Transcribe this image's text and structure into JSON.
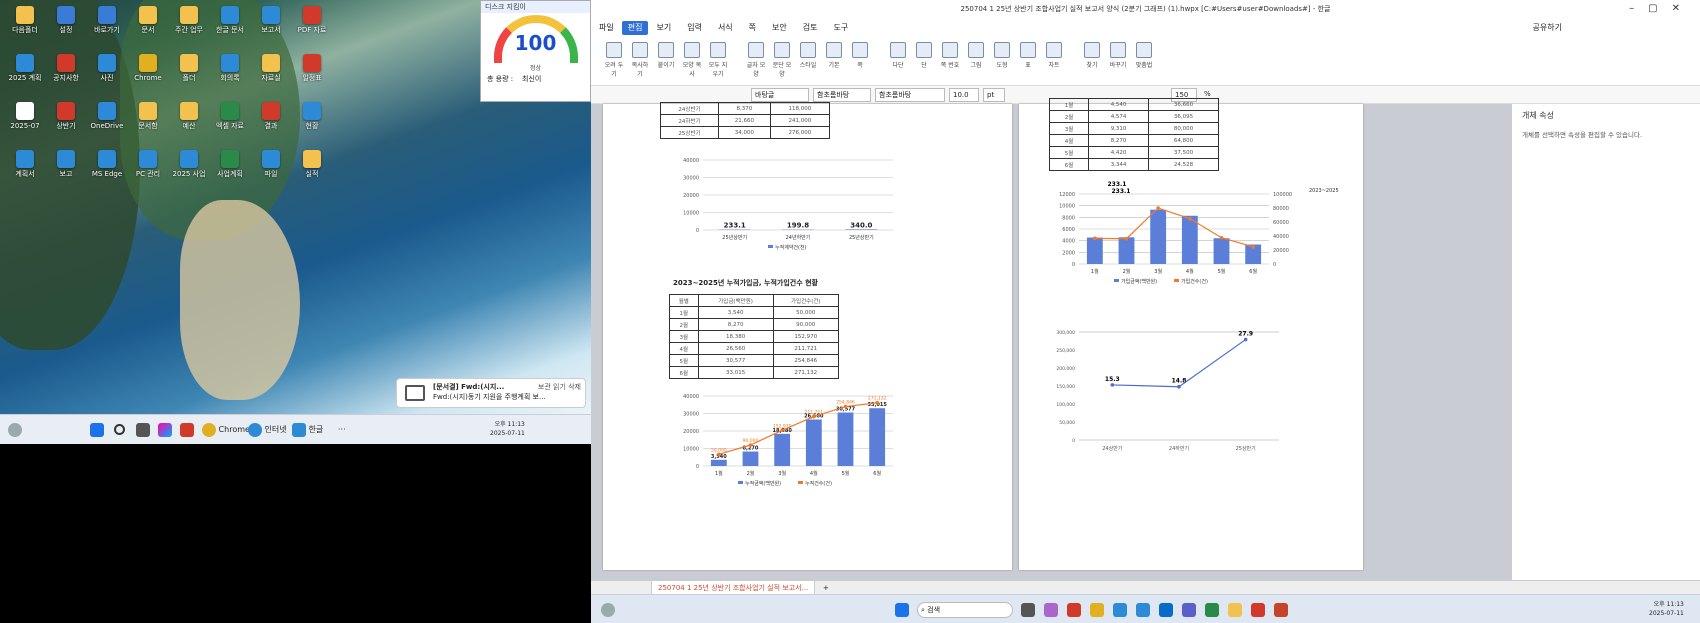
{
  "gauge": {
    "title": "디스크 지킴이",
    "value": "100",
    "sub": "정상",
    "label": "총 용량 :",
    "status": "최신이"
  },
  "notify": {
    "title": "[문서결] Fwd:(시지...",
    "body": "Fwd:(시지)동기 지원을 주행계획 보...",
    "actions": "보관  읽기  삭제"
  },
  "left_taskbar": {
    "search": "",
    "chrome": "Chrome",
    "edge": "인터넷",
    "hwp": "한글",
    "time": "오후 11:13",
    "date": "2025-07-11"
  },
  "desktop_icons": [
    {
      "label": "다음폴더",
      "color": "#f2c14e"
    },
    {
      "label": "설정",
      "color": "#3a7bd5"
    },
    {
      "label": "바로가기",
      "color": "#3a7bd5"
    },
    {
      "label": "문서",
      "color": "#f2c14e"
    },
    {
      "label": "주간 업무",
      "color": "#f2c14e"
    },
    {
      "label": "한글 문서",
      "color": "#2d8ad6"
    },
    {
      "label": "보고서",
      "color": "#2d8ad6"
    },
    {
      "label": "PDF 자료",
      "color": "#d13a2a"
    },
    {
      "label": "2025 계획",
      "color": "#2d8ad6"
    },
    {
      "label": "공지사항",
      "color": "#d13a2a"
    },
    {
      "label": "사진",
      "color": "#2d8ad6"
    },
    {
      "label": "Chrome",
      "color": "#e0b020"
    },
    {
      "label": "폴더",
      "color": "#f2c14e"
    },
    {
      "label": "회의록",
      "color": "#2d8ad6"
    },
    {
      "label": "자료실",
      "color": "#f2c14e"
    },
    {
      "label": "일정표",
      "color": "#d13a2a"
    },
    {
      "label": "2025-07",
      "color": "#fff"
    },
    {
      "label": "상반기",
      "color": "#d13a2a"
    },
    {
      "label": "OneDrive",
      "color": "#2d8ad6"
    },
    {
      "label": "문서함",
      "color": "#f2c14e"
    },
    {
      "label": "예산",
      "color": "#f2c14e"
    },
    {
      "label": "엑셀 자료",
      "color": "#2a8a4a"
    },
    {
      "label": "결과",
      "color": "#d13a2a"
    },
    {
      "label": "현황",
      "color": "#2d8ad6"
    },
    {
      "label": "계획서",
      "color": "#2d8ad6"
    },
    {
      "label": "보고",
      "color": "#2d8ad6"
    },
    {
      "label": "MS Edge",
      "color": "#2d8ad6"
    },
    {
      "label": "PC 관리",
      "color": "#2d8ad6"
    },
    {
      "label": "2025 사업",
      "color": "#2d8ad6"
    },
    {
      "label": "사업계획",
      "color": "#2a8a4a"
    },
    {
      "label": "파일",
      "color": "#2d8ad6"
    },
    {
      "label": "실적",
      "color": "#f2c14e"
    }
  ],
  "window": {
    "title": "250704 1 25년 상반기 조합사업기 실적 보고서 양식 (2분기 그래프) (1).hwpx [C:#Users#user#Downloads#]  - 한글",
    "share": "공유하기"
  },
  "menu": [
    "파일",
    "편집",
    "보기",
    "입력",
    "서식",
    "쪽",
    "보안",
    "검토",
    "도구"
  ],
  "ribbon": [
    "오려 두기",
    "복사하기",
    "붙이기",
    "모양 복사",
    "모두 지우기",
    "글자 모양",
    "문단 모양",
    "스타일",
    "기본",
    "쪽",
    "다단",
    "단",
    "쪽 번호",
    "그림",
    "도형",
    "표",
    "차트",
    "찾기",
    "바꾸기",
    "맞춤법"
  ],
  "format": {
    "style": "바탕글",
    "font": "함초롬바탕",
    "size": "10.0",
    "unit": "pt",
    "zoom": "150",
    "pct": "%"
  },
  "page1": {
    "table1_rows": [
      [
        "24상반기",
        "8,370",
        "118,000"
      ],
      [
        "24하반기",
        "21,660",
        "241,000"
      ],
      [
        "25상반기",
        "34,000",
        "276,000"
      ]
    ],
    "chart1": {
      "type": "bar",
      "categories": [
        "25년상반기",
        "24년하반기",
        "25년상반기"
      ],
      "values": [
        233.1,
        199.8,
        340.0
      ],
      "labels": [
        "233.1",
        "199.8",
        "340.0"
      ],
      "ylim": [
        0,
        40000
      ],
      "yticks": [
        "0",
        "10000",
        "20000",
        "30000",
        "40000"
      ],
      "legend": "누적계약건(천)"
    },
    "section_title": "2023~2025년 누적가입금, 누적가입건수 현황",
    "table2_head": [
      "월별",
      "가입금(백만원)",
      "가입건수(건)"
    ],
    "table2_rows": [
      [
        "1월",
        "3,540",
        "50,000"
      ],
      [
        "2월",
        "8,270",
        "90,000"
      ],
      [
        "3월",
        "18,380",
        "152,970"
      ],
      [
        "4월",
        "26,560",
        "211,721"
      ],
      [
        "5월",
        "30,577",
        "254,846"
      ],
      [
        "6월",
        "33,015",
        "271,132"
      ]
    ],
    "chart2": {
      "type": "bar",
      "categories": [
        "1월",
        "2월",
        "3월",
        "4월",
        "5월",
        "6월"
      ],
      "values": [
        3540,
        8270,
        18380,
        26560,
        30577,
        33015
      ],
      "line_values": [
        50000,
        90000,
        152970,
        211721,
        254846,
        271132
      ],
      "bar_labels": [
        "3,540",
        "8,270",
        "18,380",
        "26,560",
        "30,577",
        "33,015"
      ],
      "line_labels": [
        "50,000",
        "90,000",
        "152,970",
        "211,721",
        "254,846",
        "271,132"
      ],
      "ylim": [
        0,
        40000
      ],
      "yticks": [
        "0",
        "10000",
        "20000",
        "30000",
        "40000"
      ],
      "legend": [
        "누적금액(백만원)",
        "누적건수(건)"
      ]
    }
  },
  "page2": {
    "table3_rows": [
      [
        "1월",
        "4,540",
        "36,660"
      ],
      [
        "2월",
        "4,574",
        "36,095"
      ],
      [
        "3월",
        "9,310",
        "80,000"
      ],
      [
        "4월",
        "8,270",
        "64,800"
      ],
      [
        "5월",
        "4,420",
        "37,500"
      ],
      [
        "6월",
        "3,344",
        "24,528"
      ]
    ],
    "chart3": {
      "type": "bar",
      "categories": [
        "1월",
        "2월",
        "3월",
        "4월",
        "5월",
        "6월"
      ],
      "values": [
        4540,
        4574,
        9310,
        8270,
        4420,
        3344
      ],
      "line_values": [
        36660,
        36095,
        80000,
        64800,
        37500,
        24528
      ],
      "labels_top": [
        "233.1",
        "233.1"
      ],
      "ylim": [
        0,
        12000
      ],
      "yticks": [
        "0",
        "2000",
        "4000",
        "6000",
        "8000",
        "10000",
        "12000"
      ],
      "y2ticks": [
        "0",
        "20000",
        "40000",
        "60000",
        "80000",
        "100000"
      ],
      "legend": [
        "가입금액(백만원)",
        "가입건수(건)"
      ],
      "side_label": "2023~2025"
    },
    "chart4": {
      "type": "line",
      "categories": [
        "24상반기",
        "24하반기",
        "25상반기"
      ],
      "values": [
        153,
        148,
        279
      ],
      "labels": [
        "15.3",
        "14.8",
        "27.9"
      ],
      "ylim": [
        0,
        300
      ],
      "yticks": [
        "0",
        "50,000",
        "100,000",
        "150,000",
        "200,000",
        "250,000",
        "300,000"
      ]
    }
  },
  "side_panel": {
    "title": "개체 속성",
    "desc": "개체를 선택하면 속성을 편집할 수 있습니다."
  },
  "tab": {
    "name": "250704 1 25년 상반기 조합사업기 실적 보고서..."
  },
  "right_taskbar": {
    "search": "검색",
    "time": "오후 11:13",
    "date": "2025-07-11"
  }
}
